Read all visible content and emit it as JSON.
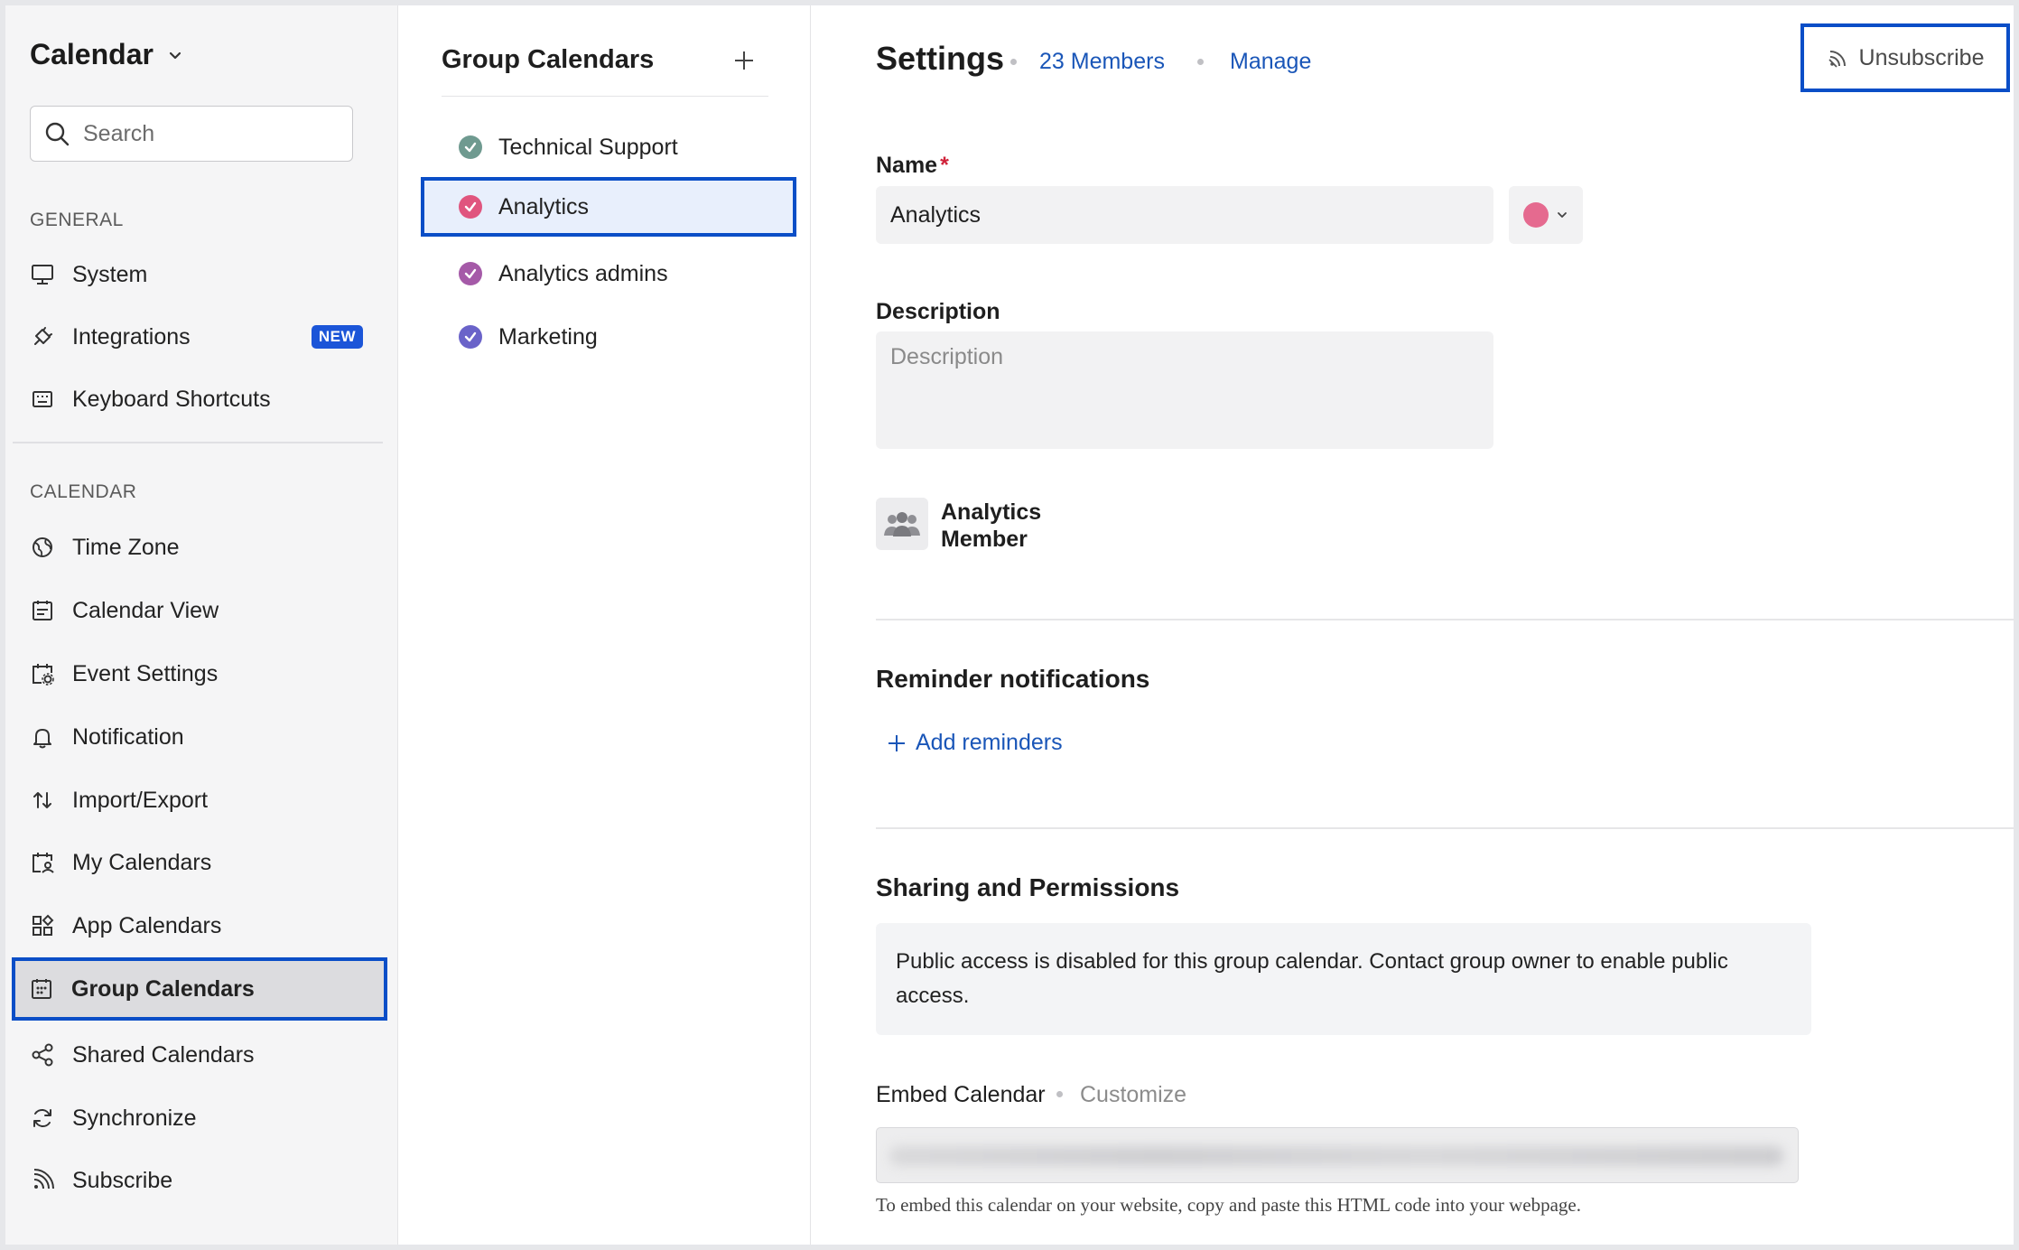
{
  "sidebar": {
    "app_title": "Calendar",
    "search_placeholder": "Search",
    "general_label": "GENERAL",
    "calendar_label": "CALENDAR",
    "general_items": [
      {
        "label": "System",
        "icon": "monitor-icon"
      },
      {
        "label": "Integrations",
        "icon": "plug-icon",
        "badge": "NEW"
      },
      {
        "label": "Keyboard Shortcuts",
        "icon": "keyboard-icon"
      }
    ],
    "calendar_items": [
      {
        "label": "Time Zone",
        "icon": "globe-icon"
      },
      {
        "label": "Calendar View",
        "icon": "calendar-view-icon"
      },
      {
        "label": "Event Settings",
        "icon": "event-settings-icon"
      },
      {
        "label": "Notification",
        "icon": "bell-icon"
      },
      {
        "label": "Import/Export",
        "icon": "import-export-icon"
      },
      {
        "label": "My Calendars",
        "icon": "my-calendars-icon"
      },
      {
        "label": "App Calendars",
        "icon": "app-grid-icon"
      },
      {
        "label": "Group Calendars",
        "icon": "group-calendar-icon",
        "active": true
      },
      {
        "label": "Shared Calendars",
        "icon": "share-icon"
      },
      {
        "label": "Synchronize",
        "icon": "sync-icon"
      },
      {
        "label": "Subscribe",
        "icon": "rss-icon"
      }
    ]
  },
  "group_list": {
    "title": "Group Calendars",
    "items": [
      {
        "label": "Technical Support",
        "color": "#6f9a90"
      },
      {
        "label": "Analytics",
        "color": "#e0557e",
        "active": true
      },
      {
        "label": "Analytics admins",
        "color": "#a55aa8"
      },
      {
        "label": "Marketing",
        "color": "#6a63c9"
      }
    ]
  },
  "settings": {
    "title": "Settings",
    "members_link": "23 Members",
    "manage_link": "Manage",
    "unsubscribe_label": "Unsubscribe",
    "name_label": "Name",
    "required_mark": "*",
    "name_value": "Analytics",
    "selected_color": "#e56a8f",
    "description_label": "Description",
    "description_placeholder": "Description",
    "group_name_line1": "Analytics",
    "group_name_line2": "Member",
    "reminder_title": "Reminder notifications",
    "add_reminders": "Add reminders",
    "sharing_title": "Sharing and Permissions",
    "sharing_info": "Public access is disabled for this group calendar. Contact group owner to enable public access.",
    "embed_label": "Embed Calendar",
    "customize_label": "Customize",
    "embed_help": "To embed this calendar on your website, copy and paste this HTML code into your webpage."
  },
  "colors": {
    "accent": "#1a56b8",
    "highlight_border": "#0a4ec7",
    "badge": "#1b55d8"
  }
}
